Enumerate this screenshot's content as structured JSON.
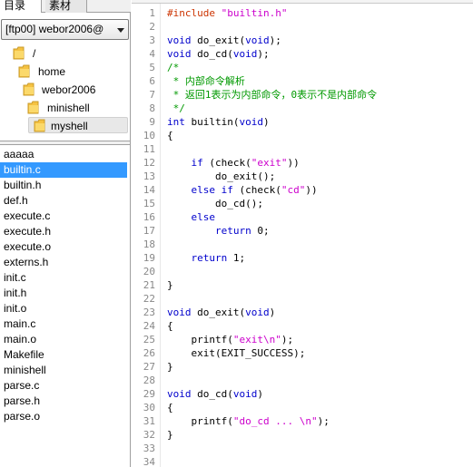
{
  "tabs": [
    {
      "label": "目录"
    },
    {
      "label": "素材"
    }
  ],
  "connection": {
    "value": "[ftp00] webor2006@"
  },
  "dir_tree": [
    {
      "label": "/"
    },
    {
      "label": "home"
    },
    {
      "label": "webor2006"
    },
    {
      "label": "minishell"
    },
    {
      "label": "myshell"
    }
  ],
  "files": [
    "aaaaa",
    "builtin.c",
    "builtin.h",
    "def.h",
    "execute.c",
    "execute.h",
    "execute.o",
    "externs.h",
    "init.c",
    "init.h",
    "init.o",
    "main.c",
    "main.o",
    "Makefile",
    "minishell",
    "parse.c",
    "parse.h",
    "parse.o"
  ],
  "selected_file": "builtin.c",
  "editor": {
    "lines": [
      {
        "n": "1",
        "segs": [
          [
            "pp",
            "#include "
          ],
          [
            "str",
            "\"builtin.h\""
          ]
        ]
      },
      {
        "n": "2",
        "segs": []
      },
      {
        "n": "3",
        "segs": [
          [
            "kw",
            "void"
          ],
          [
            "pl",
            " do_exit("
          ],
          [
            "kw",
            "void"
          ],
          [
            "pl",
            ");"
          ]
        ]
      },
      {
        "n": "4",
        "segs": [
          [
            "kw",
            "void"
          ],
          [
            "pl",
            " do_cd("
          ],
          [
            "kw",
            "void"
          ],
          [
            "pl",
            ");"
          ]
        ]
      },
      {
        "n": "5",
        "segs": [
          [
            "cm",
            "/*"
          ]
        ]
      },
      {
        "n": "6",
        "segs": [
          [
            "cm",
            " * 内部命令解析"
          ]
        ]
      },
      {
        "n": "7",
        "segs": [
          [
            "cm",
            " * 返回1表示为内部命令，0表示不是内部命令"
          ]
        ]
      },
      {
        "n": "8",
        "segs": [
          [
            "cm",
            " */"
          ]
        ]
      },
      {
        "n": "9",
        "segs": [
          [
            "kw",
            "int"
          ],
          [
            "pl",
            " builtin("
          ],
          [
            "kw",
            "void"
          ],
          [
            "pl",
            ")"
          ]
        ]
      },
      {
        "n": "10",
        "segs": [
          [
            "pl",
            "{"
          ]
        ]
      },
      {
        "n": "11",
        "segs": []
      },
      {
        "n": "12",
        "segs": [
          [
            "pl",
            "    "
          ],
          [
            "kw",
            "if"
          ],
          [
            "pl",
            " (check("
          ],
          [
            "str",
            "\"exit\""
          ],
          [
            "pl",
            "))"
          ]
        ]
      },
      {
        "n": "13",
        "segs": [
          [
            "pl",
            "        do_exit();"
          ]
        ]
      },
      {
        "n": "14",
        "segs": [
          [
            "pl",
            "    "
          ],
          [
            "kw",
            "else if"
          ],
          [
            "pl",
            " (check("
          ],
          [
            "str",
            "\"cd\""
          ],
          [
            "pl",
            "))"
          ]
        ]
      },
      {
        "n": "15",
        "segs": [
          [
            "pl",
            "        do_cd();"
          ]
        ]
      },
      {
        "n": "16",
        "segs": [
          [
            "pl",
            "    "
          ],
          [
            "kw",
            "else"
          ]
        ]
      },
      {
        "n": "17",
        "segs": [
          [
            "pl",
            "        "
          ],
          [
            "kw",
            "return"
          ],
          [
            "pl",
            " 0;"
          ]
        ]
      },
      {
        "n": "18",
        "segs": []
      },
      {
        "n": "19",
        "segs": [
          [
            "pl",
            "    "
          ],
          [
            "kw",
            "return"
          ],
          [
            "pl",
            " 1;"
          ]
        ]
      },
      {
        "n": "20",
        "segs": []
      },
      {
        "n": "21",
        "segs": [
          [
            "pl",
            "}"
          ]
        ]
      },
      {
        "n": "22",
        "segs": []
      },
      {
        "n": "23",
        "segs": [
          [
            "kw",
            "void"
          ],
          [
            "pl",
            " do_exit("
          ],
          [
            "kw",
            "void"
          ],
          [
            "pl",
            ")"
          ]
        ]
      },
      {
        "n": "24",
        "segs": [
          [
            "pl",
            "{"
          ]
        ]
      },
      {
        "n": "25",
        "segs": [
          [
            "pl",
            "    printf("
          ],
          [
            "str",
            "\"exit\\n\""
          ],
          [
            "pl",
            ");"
          ]
        ]
      },
      {
        "n": "26",
        "segs": [
          [
            "pl",
            "    exit(EXIT_SUCCESS);"
          ]
        ]
      },
      {
        "n": "27",
        "segs": [
          [
            "pl",
            "}"
          ]
        ]
      },
      {
        "n": "28",
        "segs": []
      },
      {
        "n": "29",
        "segs": [
          [
            "kw",
            "void"
          ],
          [
            "pl",
            " do_cd("
          ],
          [
            "kw",
            "void"
          ],
          [
            "pl",
            ")"
          ]
        ]
      },
      {
        "n": "30",
        "segs": [
          [
            "pl",
            "{"
          ]
        ]
      },
      {
        "n": "31",
        "segs": [
          [
            "pl",
            "    printf("
          ],
          [
            "str",
            "\"do_cd ... \\n\""
          ],
          [
            "pl",
            ");"
          ]
        ]
      },
      {
        "n": "32",
        "segs": [
          [
            "pl",
            "}"
          ]
        ]
      },
      {
        "n": "33",
        "segs": []
      },
      {
        "n": "34",
        "segs": []
      }
    ]
  },
  "icons": {
    "folder": "folder-icon",
    "dropdown": "chevron-down-icon"
  },
  "colors": {
    "keyword": "#0000cc",
    "string": "#cc00cc",
    "preprocessor": "#cc3300",
    "comment": "#009900",
    "selection": "#3399ff",
    "folder": "#f5c242"
  }
}
